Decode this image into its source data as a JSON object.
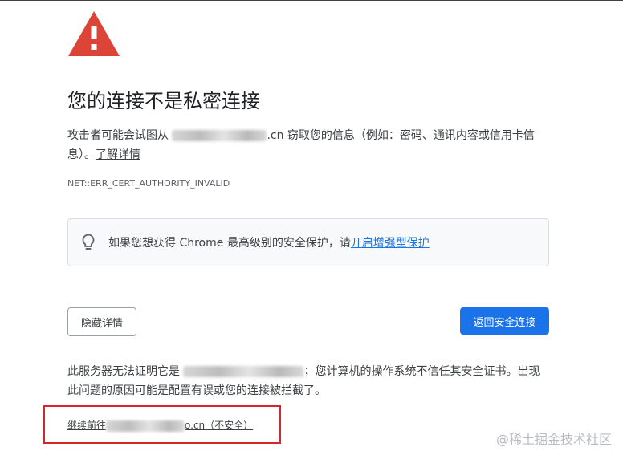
{
  "icons": {
    "warning": "warning-triangle-icon",
    "bulb": "lightbulb-icon"
  },
  "colors": {
    "warning_red": "#db4437",
    "primary_blue": "#1a73e8",
    "annotation_red": "#d9232f",
    "info_box_background": "#f8f9fa"
  },
  "interstitial": {
    "heading": "您的连接不是私密连接",
    "description_prefix": "攻击者可能会试图从 ",
    "description_domain_visible": ".cn",
    "description_suffix": " 窃取您的信息（例如：密码、通讯内容或信用卡信息）。",
    "learn_more": "了解详情",
    "error_code": "NET::ERR_CERT_AUTHORITY_INVALID"
  },
  "enhanced_protection": {
    "text": "如果您想获得 Chrome 最高级别的安全保护，请",
    "link": "开启增强型保护"
  },
  "buttons": {
    "hide_details": "隐藏详情",
    "back_to_safety": "返回安全连接"
  },
  "details": {
    "prefix": "此服务器无法证明它是 ",
    "suffix": "；您计算机的操作系统不信任其安全证书。出现此问题的原因可能是配置有误或您的连接被拦截了。"
  },
  "proceed": {
    "prefix": "继续前往",
    "domain_visible": "o.cn",
    "suffix": "（不安全）"
  },
  "watermark": "@稀土掘金技术社区"
}
